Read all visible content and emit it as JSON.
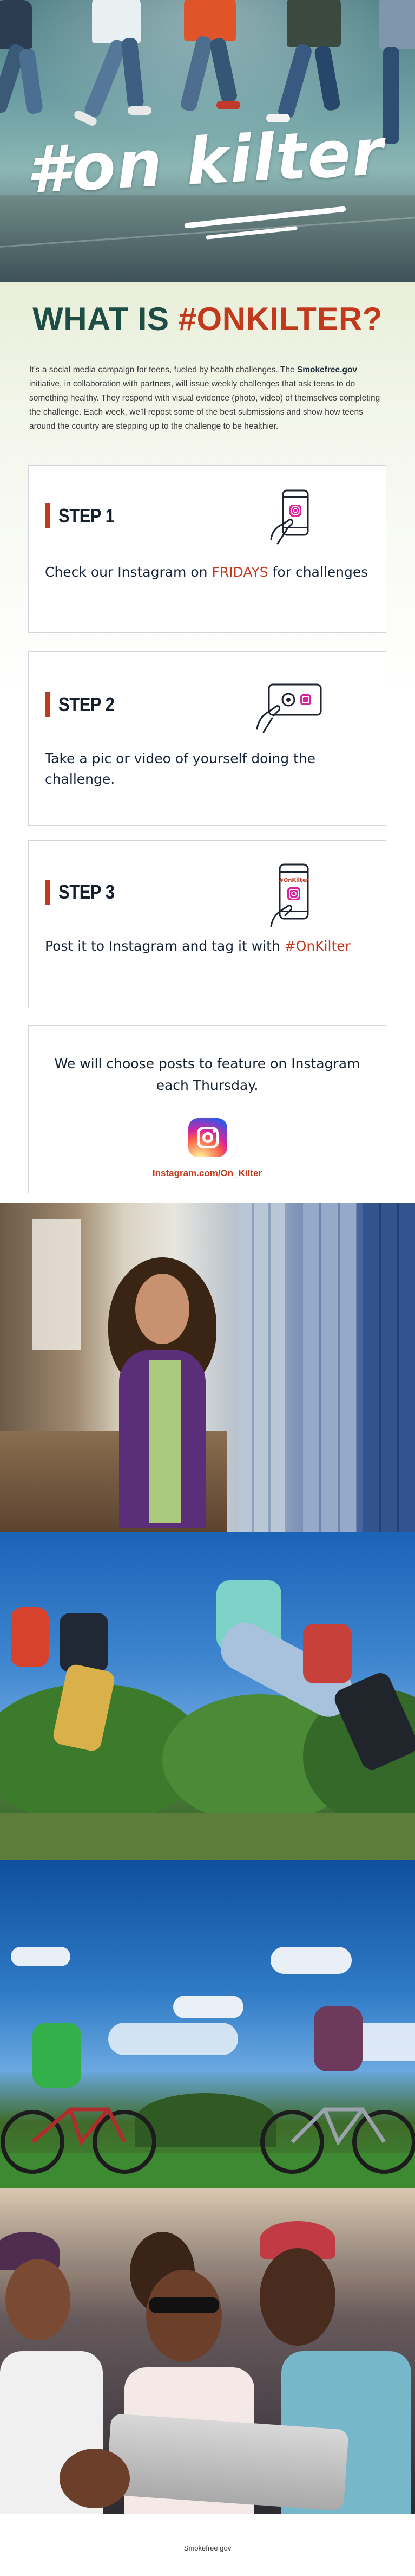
{
  "hero": {
    "hashtag": "#on kilter"
  },
  "intro": {
    "title_prefix": "WHAT IS ",
    "title_accent": "#ONKILTER?",
    "p_before": "It’s a social media campaign for teens, fueled by health challenges. The ",
    "p_bold": "Smokefree.gov",
    "p_after": " initiative, in collaboration with partners, will issue weekly challenges that ask teens to do something healthy. They respond with visual evidence (photo, video) of themselves completing the challenge. Each week, we’ll repost some of the best submissions and show how teens around the country are stepping up to the challenge to be healthier."
  },
  "steps": [
    {
      "label": "STEP 1",
      "text_before": "Check our Instagram on ",
      "text_accent": "FRIDAYS",
      "text_after": " for challenges",
      "icon": "phone-instagram-icon"
    },
    {
      "label": "STEP 2",
      "text_before": "Take a pic or video of yourself doing the challenge.",
      "text_accent": "",
      "text_after": "",
      "icon": "phone-camera-icon"
    },
    {
      "label": "STEP 3",
      "text_before": "Post it to Instagram and tag it with ",
      "text_accent": "#OnKilter",
      "text_after": "",
      "icon": "phone-hashtag-icon"
    }
  ],
  "feature": {
    "text": "We will choose posts to feature on Instagram each Thursday.",
    "icon": "instagram-icon",
    "link": "Instagram.com/On_Kilter"
  },
  "phone_tag": "#OnKilter",
  "footer": {
    "text": "Smokefree.gov"
  },
  "colors": {
    "accent": "#c23a1e",
    "title": "#1d4d44",
    "body": "#15212e"
  }
}
